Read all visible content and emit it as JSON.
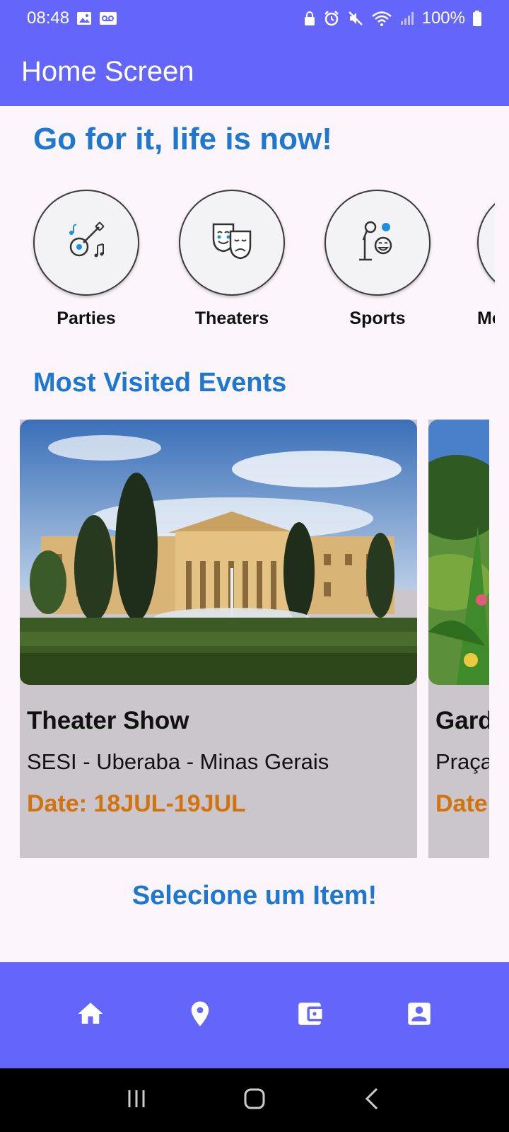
{
  "status_bar": {
    "time": "08:48",
    "battery": "100%",
    "icons": [
      "image-icon",
      "voicemail-icon",
      "lock-icon",
      "alarm-icon",
      "mute-icon",
      "wifi-icon",
      "signal-icon",
      "battery-icon"
    ]
  },
  "app_bar": {
    "title": "Home Screen"
  },
  "headline": "Go for it, life is now!",
  "categories": [
    {
      "label": "Parties",
      "icon": "guitar-music-icon"
    },
    {
      "label": "Theaters",
      "icon": "theater-masks-icon"
    },
    {
      "label": "Sports",
      "icon": "microphone-icon"
    },
    {
      "label": "Mo",
      "icon": "category-icon"
    }
  ],
  "section_title": "Most Visited Events",
  "events": [
    {
      "title": "Theater Show",
      "place": "SESI - Uberaba - Minas Gerais",
      "date": "Date: 18JUL-19JUL",
      "image": "museum-palace-photo"
    },
    {
      "title": "Gard",
      "place": "Praça",
      "date": "Date",
      "image": "garden-photo"
    }
  ],
  "select_message": "Selecione um Item!",
  "bottom_nav": [
    {
      "name": "home",
      "icon": "home-icon"
    },
    {
      "name": "location",
      "icon": "location-pin-icon"
    },
    {
      "name": "wallet",
      "icon": "wallet-icon"
    },
    {
      "name": "profile",
      "icon": "profile-icon"
    }
  ],
  "colors": {
    "primary": "#6466fb",
    "accent_text": "#1e78d0",
    "date_text": "#d1730f",
    "card_bg": "#cbc6cb",
    "background": "#fcf5fb"
  }
}
